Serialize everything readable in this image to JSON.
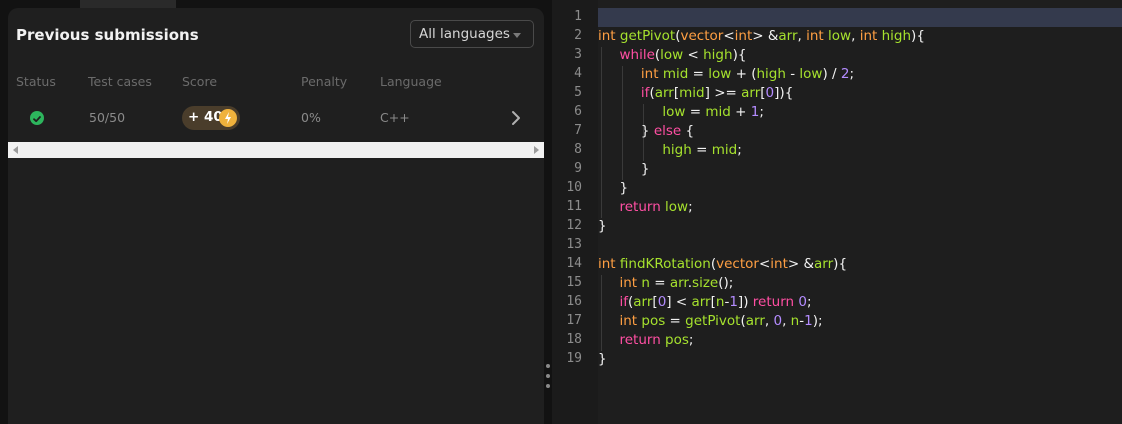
{
  "submissions": {
    "title": "Previous submissions",
    "language_filter": "All languages",
    "columns": [
      "Status",
      "Test cases",
      "Score",
      "Penalty",
      "Language"
    ],
    "rows": [
      {
        "status": "passed",
        "test_cases": "50/50",
        "score": "+ 40",
        "penalty": "0%",
        "language": "C++"
      }
    ]
  },
  "editor": {
    "active_line": 1,
    "line_numbers": [
      "1",
      "2",
      "3",
      "4",
      "5",
      "6",
      "7",
      "8",
      "9",
      "10",
      "11",
      "12",
      "13",
      "14",
      "15",
      "16",
      "17",
      "18",
      "19"
    ],
    "lines": [
      "",
      "int getPivot(vector<int> &arr, int low, int high){",
      "    while(low < high){",
      "        int mid = low + (high - low) / 2;",
      "        if(arr[mid] >= arr[0]){",
      "            low = mid + 1;",
      "        } else {",
      "            high = mid;",
      "        }",
      "    }",
      "    return low;",
      "}",
      "",
      "int findKRotation(vector<int> &arr){",
      "    int n = arr.size();",
      "    if(arr[0] < arr[n-1]) return 0;",
      "    int pos = getPivot(arr, 0, n-1);",
      "    return pos;",
      "}"
    ]
  },
  "colors": {
    "keyword": "#ff4fa3",
    "type": "#ff9f43",
    "identifier": "#a6e22e",
    "number": "#b48cff",
    "success": "#2db55d",
    "score_badge": "#4a3d2b"
  },
  "icons": [
    "check-circle-icon",
    "lightning-bolt-icon",
    "chevron-right-icon",
    "chevron-down-icon",
    "drag-handle-icon"
  ]
}
